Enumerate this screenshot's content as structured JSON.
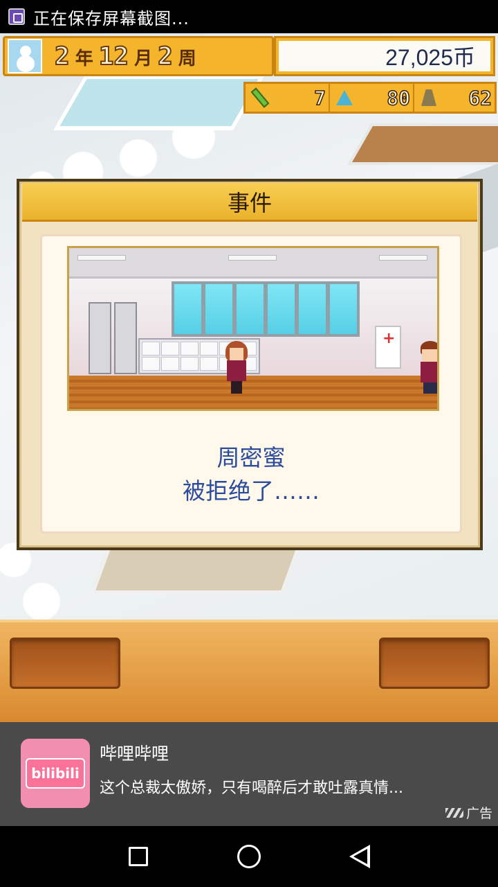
{
  "status_bar": {
    "text": "正在保存屏幕截图..."
  },
  "hud": {
    "date": {
      "year": "2",
      "year_unit": "年",
      "month": "12",
      "month_unit": "月",
      "week": "2",
      "week_unit": "周"
    },
    "money": "27,025币",
    "stats": [
      {
        "icon": "pencil-icon",
        "value": "7"
      },
      {
        "icon": "flask-icon",
        "value": "80"
      },
      {
        "icon": "weight-icon",
        "value": "62"
      }
    ]
  },
  "dialog": {
    "title": "事件",
    "message_line1": "周密蜜",
    "message_line2": "被拒绝了……"
  },
  "ad": {
    "logo_text": "bilibili",
    "title": "哔哩哔哩",
    "description": "这个总裁太傲娇，只有喝醉后才敢吐露真情...",
    "label": "广告"
  },
  "colors": {
    "hud_gold": "#f4b52c",
    "message_blue": "#2b4b9b",
    "ad_bg": "#4a4a4a",
    "bilibili_pink": "#fb7299"
  }
}
